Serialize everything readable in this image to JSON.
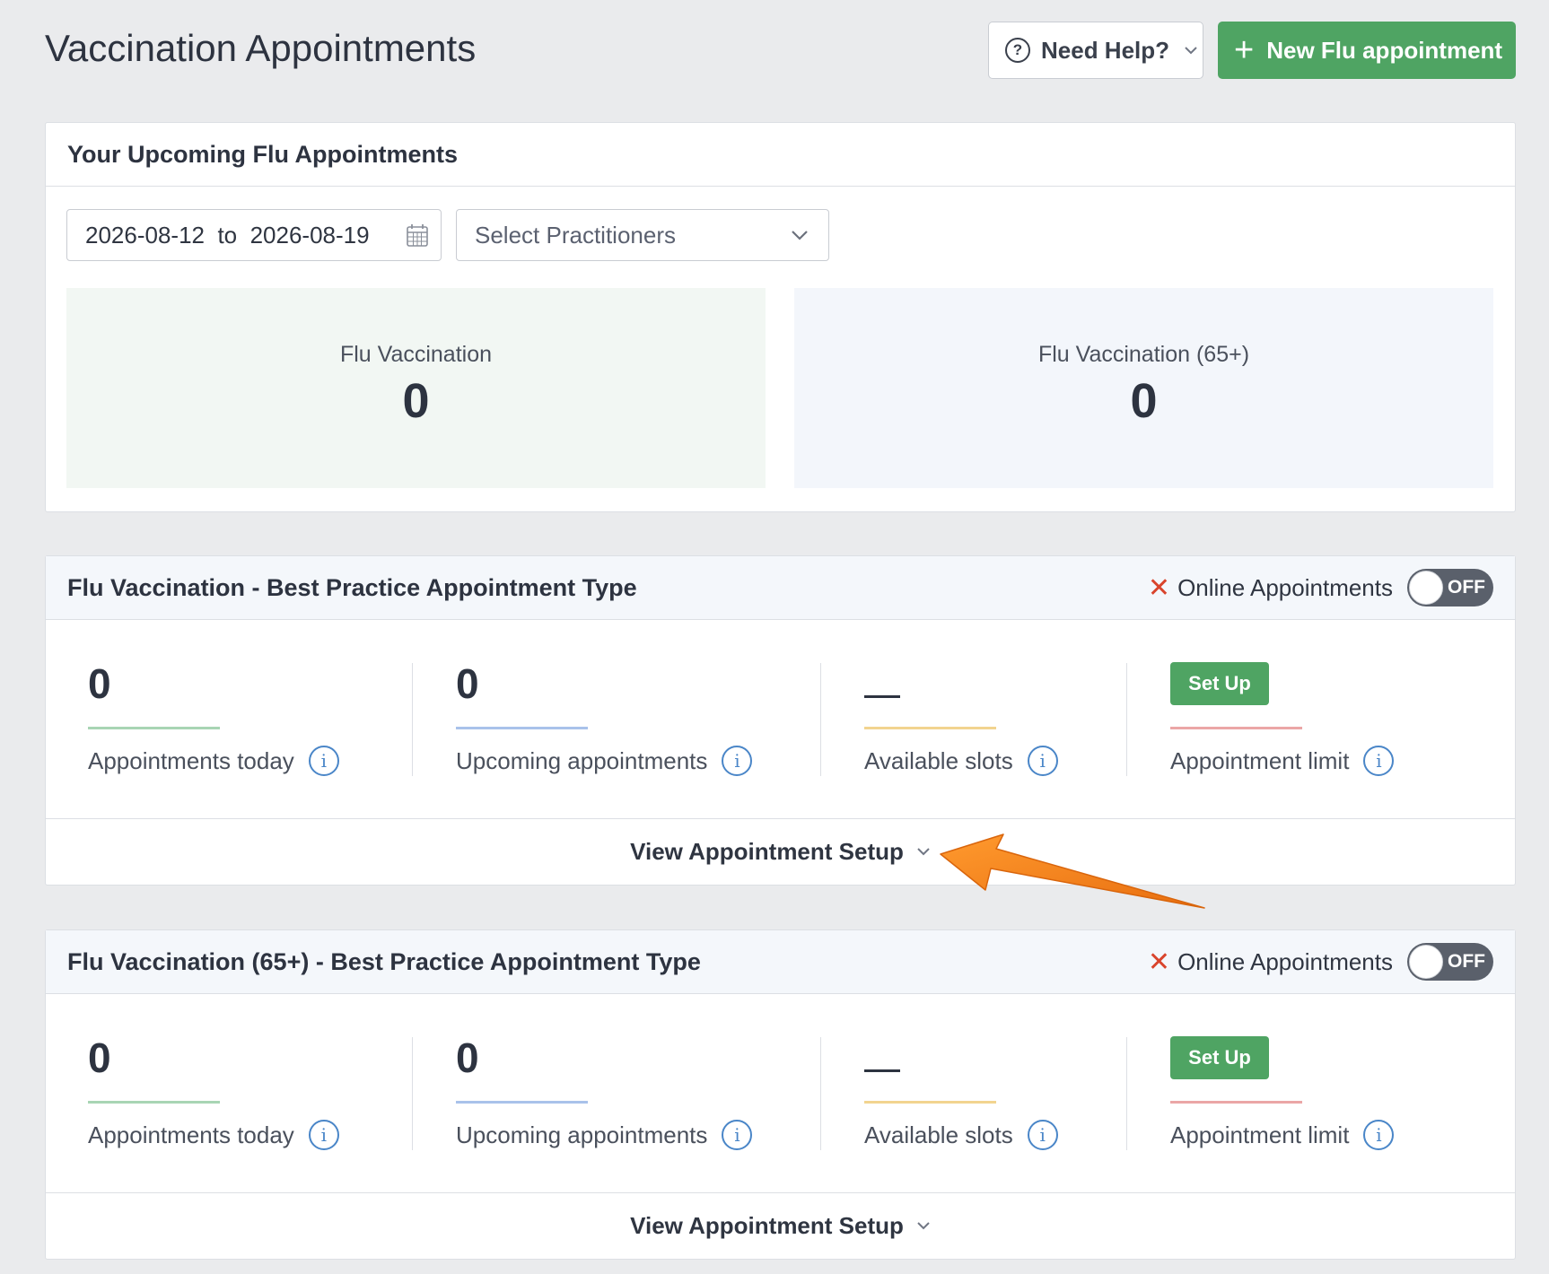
{
  "page": {
    "title": "Vaccination Appointments"
  },
  "header": {
    "help_label": "Need Help?",
    "new_label": "New Flu appointment"
  },
  "upcoming": {
    "title": "Your Upcoming Flu Appointments",
    "date_range": "2026-08-12  to  2026-08-19",
    "practitioner_placeholder": "Select Practitioners",
    "stats": [
      {
        "label": "Flu Vaccination",
        "value": "0"
      },
      {
        "label": "Flu Vaccination (65+)",
        "value": "0"
      }
    ]
  },
  "types": [
    {
      "title": "Flu Vaccination - Best Practice Appointment Type",
      "online_label": "Online Appointments",
      "toggle_state": "OFF",
      "appointments_today": "0",
      "appointments_today_label": "Appointments today",
      "upcoming": "0",
      "upcoming_label": "Upcoming appointments",
      "available_slots_label": "Available slots",
      "setup_label": "Set Up",
      "limit_label": "Appointment limit",
      "view_setup_label": "View Appointment Setup"
    },
    {
      "title": "Flu Vaccination (65+) - Best Practice Appointment Type",
      "online_label": "Online Appointments",
      "toggle_state": "OFF",
      "appointments_today": "0",
      "appointments_today_label": "Appointments today",
      "upcoming": "0",
      "upcoming_label": "Upcoming appointments",
      "available_slots_label": "Available slots",
      "setup_label": "Set Up",
      "limit_label": "Appointment limit",
      "view_setup_label": "View Appointment Setup"
    }
  ],
  "colors": {
    "primary_green": "#4fa463",
    "info_blue": "#4a86c8",
    "bar_today": "#a8d5b4",
    "bar_upcoming": "#a9c2ea",
    "bar_slots": "#f2d48f",
    "bar_limit": "#eba6a6",
    "annotation_arrow": "#f08020"
  },
  "icons": {
    "help": "question-circle-icon",
    "new": "plus-icon",
    "calendar": "calendar-icon",
    "dropdown": "chevron-down-icon",
    "online_disabled": "x-icon",
    "info": "info-circle-icon"
  }
}
